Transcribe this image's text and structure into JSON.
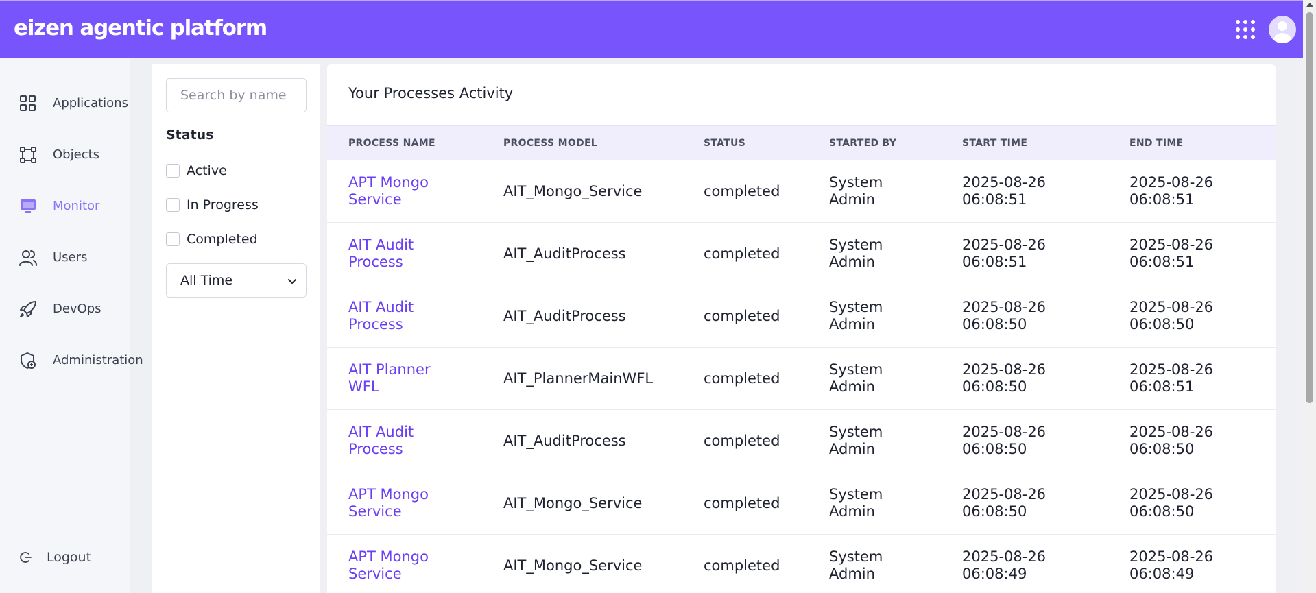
{
  "header": {
    "brand": "eizen agentic platform",
    "apps_icon": "grid-dots-icon",
    "avatar_icon": "user-avatar-icon"
  },
  "sidebar": {
    "items": [
      {
        "label": "Applications",
        "icon": "apps-grid-icon",
        "active": false
      },
      {
        "label": "Objects",
        "icon": "objects-icon",
        "active": false
      },
      {
        "label": "Monitor",
        "icon": "monitor-icon",
        "active": true
      },
      {
        "label": "Users",
        "icon": "users-icon",
        "active": false
      },
      {
        "label": "DevOps",
        "icon": "rocket-icon",
        "active": false
      },
      {
        "label": "Administration",
        "icon": "admin-shield-icon",
        "active": false
      }
    ],
    "logout": {
      "label": "Logout",
      "icon": "logout-icon"
    }
  },
  "filters": {
    "search_placeholder": "Search by name",
    "status_title": "Status",
    "options": [
      "Active",
      "In Progress",
      "Completed"
    ],
    "time_range": "All Time"
  },
  "panel": {
    "title": "Your Processes Activity",
    "columns": [
      "PROCESS NAME",
      "PROCESS MODEL",
      "STATUS",
      "STARTED BY",
      "START TIME",
      "END TIME"
    ],
    "rows": [
      {
        "name": "APT Mongo Service",
        "model": "AIT_Mongo_Service",
        "status": "completed",
        "started_by": "System Admin",
        "start": "2025-08-26 06:08:51",
        "end": "2025-08-26 06:08:51"
      },
      {
        "name": "AIT Audit Process",
        "model": "AIT_AuditProcess",
        "status": "completed",
        "started_by": "System Admin",
        "start": "2025-08-26 06:08:51",
        "end": "2025-08-26 06:08:51"
      },
      {
        "name": "AIT Audit Process",
        "model": "AIT_AuditProcess",
        "status": "completed",
        "started_by": "System Admin",
        "start": "2025-08-26 06:08:50",
        "end": "2025-08-26 06:08:50"
      },
      {
        "name": "AIT Planner WFL",
        "model": "AIT_PlannerMainWFL",
        "status": "completed",
        "started_by": "System Admin",
        "start": "2025-08-26 06:08:50",
        "end": "2025-08-26 06:08:51"
      },
      {
        "name": "AIT Audit Process",
        "model": "AIT_AuditProcess",
        "status": "completed",
        "started_by": "System Admin",
        "start": "2025-08-26 06:08:50",
        "end": "2025-08-26 06:08:50"
      },
      {
        "name": "APT Mongo Service",
        "model": "AIT_Mongo_Service",
        "status": "completed",
        "started_by": "System Admin",
        "start": "2025-08-26 06:08:50",
        "end": "2025-08-26 06:08:50"
      },
      {
        "name": "APT Mongo Service",
        "model": "AIT_Mongo_Service",
        "status": "completed",
        "started_by": "System Admin",
        "start": "2025-08-26 06:08:49",
        "end": "2025-08-26 06:08:49"
      }
    ]
  },
  "colors": {
    "brand": "#7754fb",
    "link": "#6a3ff5",
    "active_nav": "#8a73f6",
    "table_header_bg": "#f0edfd"
  }
}
